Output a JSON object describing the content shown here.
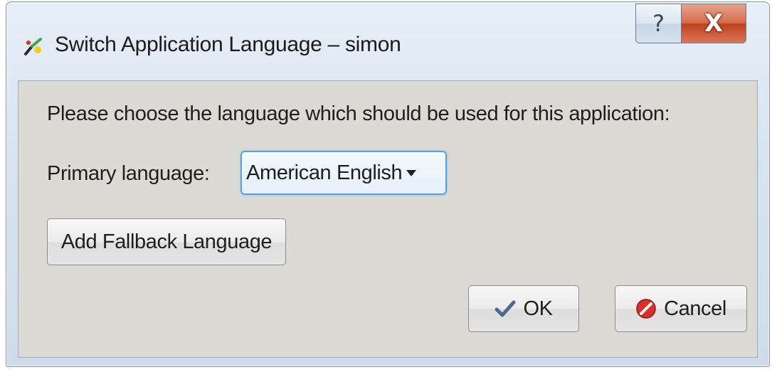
{
  "window": {
    "title": "Switch Application Language – simon",
    "app_icon": "simon-app-icon",
    "caption": {
      "help_label": "?",
      "close_label": "X"
    }
  },
  "dialog": {
    "prompt": "Please choose the language which should be used for this application:",
    "primary_language_label": "Primary language:",
    "primary_language_select": {
      "value": "American English",
      "icon": "chevron-down-icon"
    },
    "fallback_button_label": "Add Fallback Language",
    "ok_button_label": "OK",
    "ok_icon": "checkmark-icon",
    "cancel_button_label": "Cancel",
    "cancel_icon": "cancel-icon"
  },
  "colors": {
    "select_focus_border": "#5aa2d6",
    "close_button": "#c7492a",
    "dialog_background": "#dcdad5"
  }
}
